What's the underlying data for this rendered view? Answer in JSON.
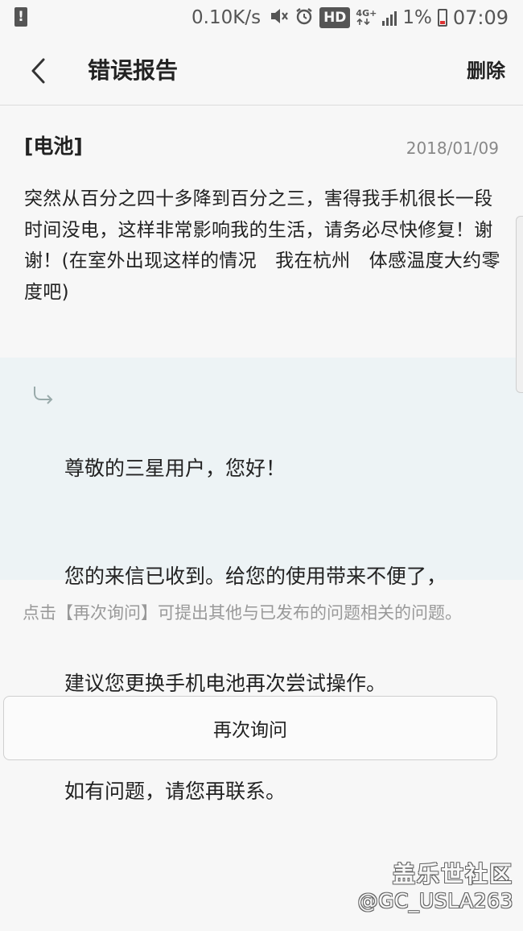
{
  "status_bar": {
    "speed": "0.10K/s",
    "mute_icon": "mute-icon",
    "alarm_icon": "alarm-icon",
    "hd_label": "HD",
    "network_label": "4G+",
    "signal_icon": "signal-icon",
    "battery_percent": "1%",
    "battery_level": 0.01,
    "time": "07:09"
  },
  "header": {
    "back_icon": "chevron-left-icon",
    "title": "错误报告",
    "delete_label": "删除"
  },
  "report": {
    "category": "[电池]",
    "date": "2018/01/09",
    "body": "突然从百分之四十多降到百分之三，害得我手机很长一段时间没电，这样非常影响我的生活，请务必尽快修复！谢谢！(在室外出现这样的情况　我在杭州　体感温度大约零度吧)"
  },
  "reply": {
    "icon": "reply-arrow-icon",
    "lines": [
      "尊敬的三星用户，您好！",
      "您的来信已收到。给您的使用带来不便了，",
      "建议您更换手机电池再次尝试操作。",
      "如有问题，请您再联系。"
    ]
  },
  "hint": "点击【再次询问】可提出其他与已发布的问题相关的问题。",
  "ask_again_label": "再次询问",
  "watermark": {
    "name": "盖乐世社区",
    "handle": "@GC_USLA263"
  },
  "colors": {
    "background": "#f7f7f7",
    "reply_background": "#edf3f5",
    "muted_text": "#999999",
    "battery_low": "#dd3333"
  }
}
